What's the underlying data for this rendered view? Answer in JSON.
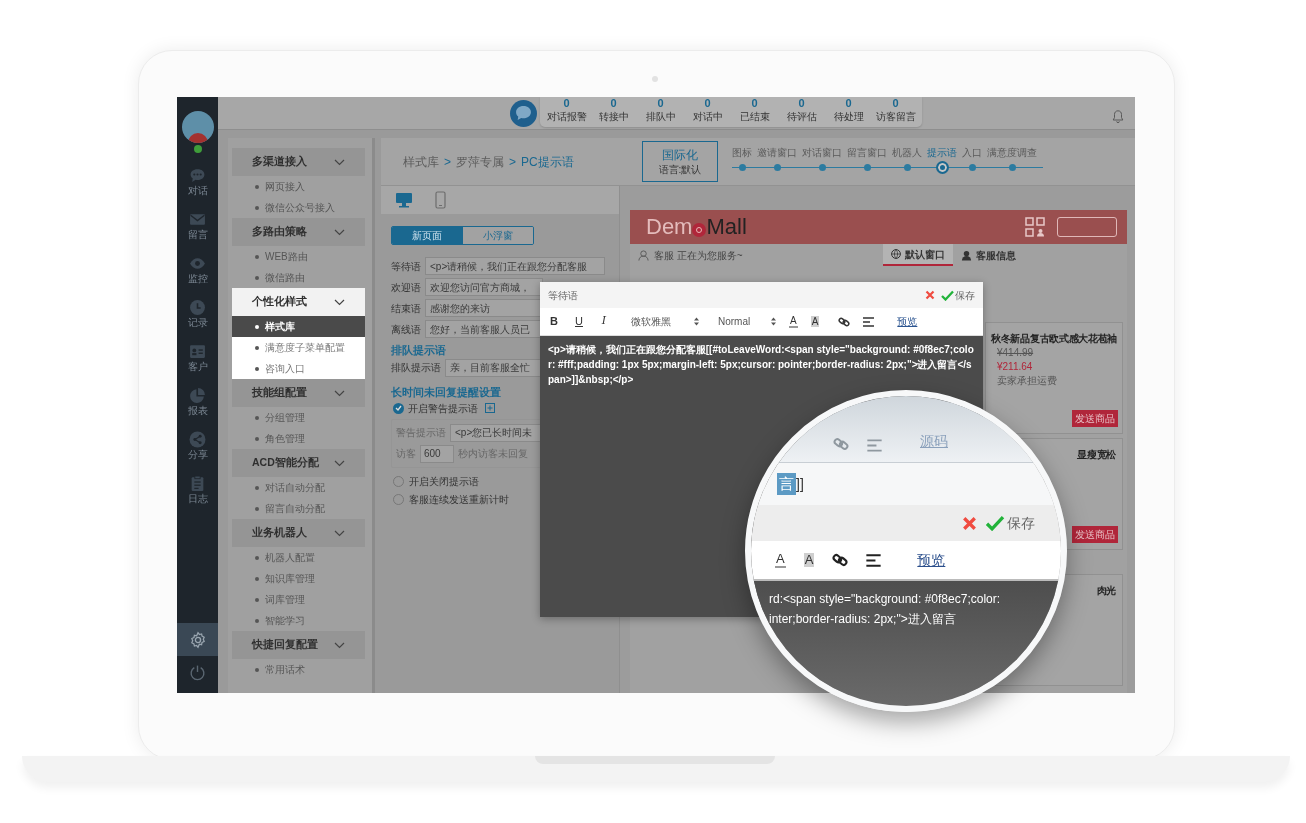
{
  "rail": {
    "avatar_online": true,
    "items": [
      {
        "kind": "chat",
        "label": "对话"
      },
      {
        "kind": "mail",
        "label": "留言"
      },
      {
        "kind": "monitor",
        "label": "监控"
      },
      {
        "kind": "history",
        "label": "记录"
      },
      {
        "kind": "customer",
        "label": "客户"
      },
      {
        "kind": "report",
        "label": "报表"
      },
      {
        "kind": "share",
        "label": "分享"
      },
      {
        "kind": "log",
        "label": "日志"
      }
    ],
    "bottom_buttons": [
      {
        "kind": "settings",
        "selected": true
      },
      {
        "kind": "power",
        "selected": false
      }
    ]
  },
  "top_bar": {
    "stats": [
      {
        "count": "0",
        "label": "对话报警"
      },
      {
        "count": "0",
        "label": "转接中"
      },
      {
        "count": "0",
        "label": "排队中"
      },
      {
        "count": "0",
        "label": "对话中"
      },
      {
        "count": "0",
        "label": "已结束"
      },
      {
        "count": "0",
        "label": "待评估"
      },
      {
        "count": "0",
        "label": "待处理"
      },
      {
        "count": "0",
        "label": "访客留言"
      }
    ]
  },
  "menu": {
    "groups": [
      {
        "title": "多渠道接入",
        "spotlight": false,
        "items": [
          {
            "label": "网页接入",
            "selected": false
          },
          {
            "label": "微信公众号接入",
            "selected": false
          }
        ]
      },
      {
        "title": "多路由策略",
        "spotlight": false,
        "items": [
          {
            "label": "WEB路由",
            "selected": false
          },
          {
            "label": "微信路由",
            "selected": false
          }
        ]
      },
      {
        "title": "个性化样式",
        "spotlight": true,
        "items": [
          {
            "label": "样式库",
            "selected": true
          },
          {
            "label": "满意度子菜单配置",
            "selected": false
          },
          {
            "label": "咨询入口",
            "selected": false
          }
        ]
      },
      {
        "title": "技能组配置",
        "spotlight": false,
        "items": [
          {
            "label": "分组管理",
            "selected": false
          },
          {
            "label": "角色管理",
            "selected": false
          }
        ]
      },
      {
        "title": "ACD智能分配",
        "spotlight": false,
        "items": [
          {
            "label": "对话自动分配",
            "selected": false
          },
          {
            "label": "留言自动分配",
            "selected": false
          }
        ]
      },
      {
        "title": "业务机器人",
        "spotlight": false,
        "items": [
          {
            "label": "机器人配置",
            "selected": false
          },
          {
            "label": "知识库管理",
            "selected": false
          },
          {
            "label": "词库管理",
            "selected": false
          },
          {
            "label": "智能学习",
            "selected": false
          }
        ]
      },
      {
        "title": "快捷回复配置",
        "spotlight": false,
        "items": [
          {
            "label": "常用话术",
            "selected": false
          }
        ]
      }
    ]
  },
  "breadcrumb": {
    "separator": ">",
    "items": [
      "样式库",
      "罗萍专属",
      "PC提示语"
    ]
  },
  "i18n": {
    "title": "国际化",
    "language": "语言:默认"
  },
  "steps": [
    {
      "label": "图标",
      "selected": false
    },
    {
      "label": "邀请窗口",
      "selected": false
    },
    {
      "label": "对话窗口",
      "selected": false
    },
    {
      "label": "留言窗口",
      "selected": false
    },
    {
      "label": "机器人",
      "selected": false
    },
    {
      "label": "提示语",
      "selected": true
    },
    {
      "label": "入口",
      "selected": false
    },
    {
      "label": "满意度调查",
      "selected": false
    }
  ],
  "device_tabs": [
    {
      "kind": "desktop",
      "selected": true
    },
    {
      "kind": "mobile",
      "selected": false
    }
  ],
  "mode_tabs": [
    {
      "label": "新页面",
      "selected": true
    },
    {
      "label": "小浮窗",
      "selected": false
    }
  ],
  "form_rows": [
    {
      "label": "等待语",
      "value": "<p>请稍候，我们正在跟您分配客服"
    },
    {
      "label": "欢迎语",
      "value": "欢迎您访问官方商城，"
    },
    {
      "label": "结束语",
      "value": "感谢您的来访"
    },
    {
      "label": "离线语",
      "value": "您好，当前客服人员已"
    }
  ],
  "queue": {
    "title": "排队提示语",
    "label": "排队提示语",
    "value": "亲，目前客服全忙"
  },
  "idle": {
    "title": "长时间未回复提醒设置",
    "warning_label": "开启警告提示语",
    "warning_checked": true,
    "field_label": "警告提示语",
    "field_value": "<p>您已长时间未",
    "visitor_label": "访客",
    "seconds": "600",
    "seconds_text": "秒内访客未回复",
    "options": [
      {
        "label": "开启关闭提示语",
        "checked": false
      },
      {
        "label": "客服连续发送重新计时",
        "checked": false
      }
    ]
  },
  "preview": {
    "logo_left": "Dem",
    "logo_right": "Mall",
    "status": "客服 正在为您服务~",
    "tabs": [
      {
        "kind": "globe",
        "label": "默认窗口",
        "selected": true
      },
      {
        "kind": "agent",
        "label": "客服信息",
        "selected": false
      }
    ],
    "products": [
      {
        "title": "秋冬新品复古欧式感大花苞袖",
        "original_price": "¥414.99",
        "price": "¥211.64",
        "shipping": "卖家承担运费",
        "button": "发送商品"
      },
      {
        "title": "显瘦宽松",
        "button": "发送商品"
      },
      {
        "title": "肉光"
      }
    ]
  },
  "modal": {
    "title": "等待语",
    "save": "保存",
    "format_buttons": [
      "B",
      "U",
      "I"
    ],
    "font": "微软雅黑",
    "size": "Normal",
    "color_glyphs": [
      "A",
      "A"
    ],
    "preview_link": "预览",
    "content": "<p>请稍候，我们正在跟您分配客服[[#toLeaveWord:<span style=\"background: #0f8ec7;color: #fff;padding: 1px 5px;margin-left: 5px;cursor: pointer;border-radius: 2px;\">进入留言</span>]]&nbsp;</p>"
  },
  "magnifier": {
    "source_link": "源码",
    "tag_text": "言",
    "tag_suffix": "]]",
    "save": "保存",
    "color_glyphs": [
      "A",
      "A"
    ],
    "preview_link": "预览",
    "code_lines": [
      "rd:<span style=\"background: #0f8ec7;color:",
      "inter;border-radius: 2px;\">进入留言"
    ]
  }
}
